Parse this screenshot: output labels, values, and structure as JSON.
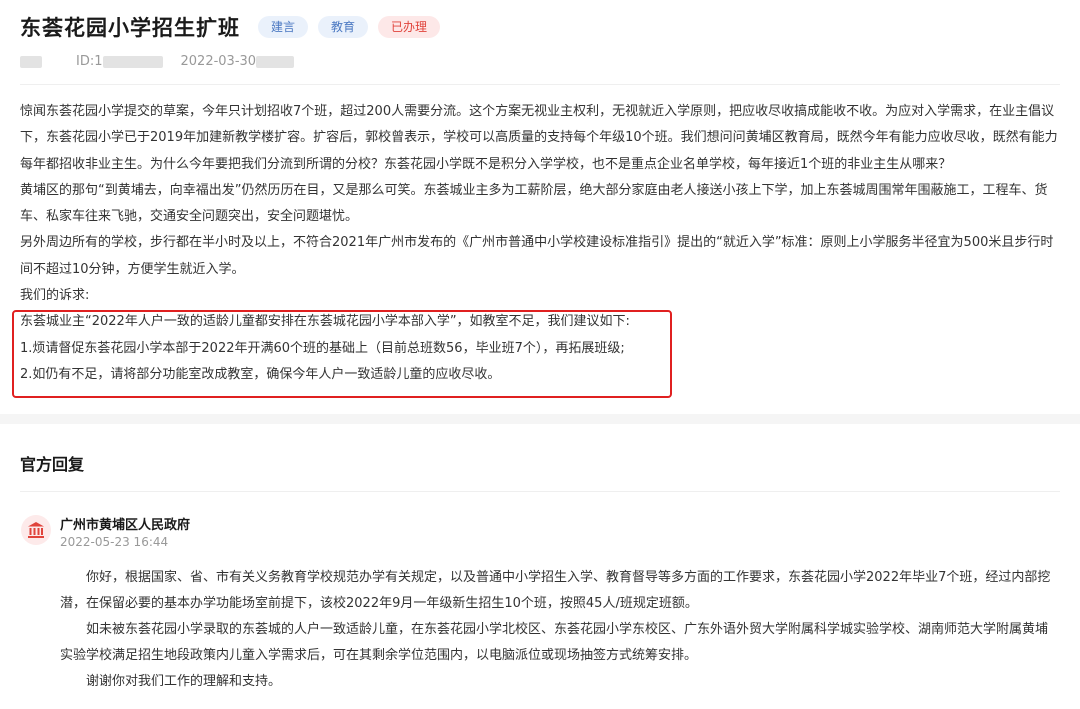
{
  "header": {
    "title": "东荟花园小学招生扩班",
    "tags": [
      "建言",
      "教育",
      "已办理"
    ],
    "id_prefix": "ID:1",
    "date_prefix": "2022-03-30"
  },
  "colors": {
    "tag_blue": "#4a78c2",
    "tag_red": "#e0443c",
    "highlight_border": "#e02020"
  },
  "body": {
    "paragraphs": [
      "惊闻东荟花园小学提交的草案，今年只计划招收7个班，超过200人需要分流。这个方案无视业主权利，无视就近入学原则，把应收尽收搞成能收不收。为应对入学需求，在业主倡议下，东荟花园小学已于2019年加建新教学楼扩容。扩容后，郭校曾表示，学校可以高质量的支持每个年级10个班。我们想问问黄埔区教育局，既然今年有能力应收尽收，既然有能力每年都招收非业主生。为什么今年要把我们分流到所谓的分校？东荟花园小学既不是积分入学学校，也不是重点企业名单学校，每年接近1个班的非业主生从哪来？",
      "黄埔区的那句“到黄埔去，向幸福出发”仍然历历在目，又是那么可笑。东荟城业主多为工薪阶层，绝大部分家庭由老人接送小孩上下学，加上东荟城周围常年围蔽施工，工程车、货车、私家车往来飞驰，交通安全问题突出，安全问题堪忧。",
      "另外周边所有的学校，步行都在半小时及以上，不符合2021年广州市发布的《广州市普通中小学校建设标准指引》提出的“就近入学”标准：原则上小学服务半径宜为500米且步行时间不超过10分钟，方便学生就近入学。",
      "我们的诉求:",
      "东荟城业主“2022年人户一致的适龄儿童都安排在东荟城花园小学本部入学”，如教室不足，我们建议如下:",
      "1.烦请督促东荟花园小学本部于2022年开满60个班的基础上（目前总班数56，毕业班7个），再拓展班级;",
      "2.如仍有不足，请将部分功能室改成教室，确保今年人户一致适龄儿童的应收尽收。"
    ]
  },
  "reply": {
    "section_title": "官方回复",
    "org_name": "广州市黄埔区人民政府",
    "time": "2022-05-23 16:44",
    "paragraphs": [
      "你好，根据国家、省、市有关义务教育学校规范办学有关规定，以及普通中小学招生入学、教育督导等多方面的工作要求，东荟花园小学2022年毕业7个班，经过内部挖潜，在保留必要的基本办学功能场室前提下，该校2022年9月一年级新生招生10个班，按照45人/班规定班额。",
      "如未被东荟花园小学录取的东荟城的人户一致适龄儿童，在东荟花园小学北校区、东荟花园小学东校区、广东外语外贸大学附属科学城实验学校、湖南师范大学附属黄埔实验学校满足招生地段政策内儿童入学需求后，可在其剩余学位范围内，以电脑派位或现场抽签方式统筹安排。",
      "谢谢你对我们工作的理解和支持。"
    ]
  },
  "icons": {
    "avatar": "government-building-icon"
  }
}
